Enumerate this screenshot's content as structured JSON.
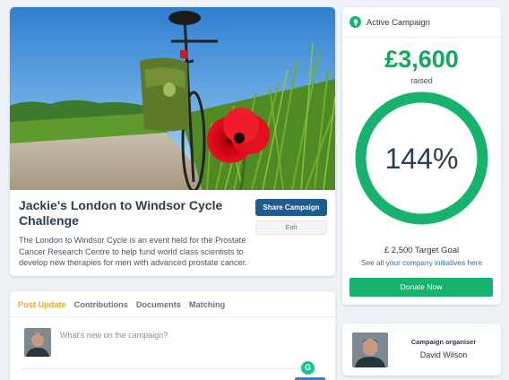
{
  "campaign": {
    "title": "Jackie's London to Windsor Cycle Challenge",
    "description": "The London to Windsor Cycle is an event held for the Prostate Cancer Research Centre to help fund world class scientists to develop new therapies for men with advanced prostate cancer.",
    "share_label": "Share Campaign",
    "edit_label": "Edit"
  },
  "post_update": {
    "tabs": [
      {
        "label": "Post Update",
        "active": true
      },
      {
        "label": "Contributions",
        "active": false
      },
      {
        "label": "Documents",
        "active": false
      },
      {
        "label": "Matching",
        "active": false
      }
    ],
    "placeholder": "What's new on the campaign?",
    "grammarly_icon": "G"
  },
  "active_campaign": {
    "header": "Active Campaign",
    "icon": "rocket-icon",
    "raised_amount": "£3,600",
    "raised_label": "raised",
    "progress_percent": 144,
    "progress_label": "144%",
    "target_goal": "£ 2,500 Target Goal",
    "initiatives_link": "See all your company initiatives here",
    "donate_label": "Donate Now"
  },
  "organiser": {
    "label": "Campaign organiser",
    "name": "David Wilson"
  },
  "colors": {
    "brand_green": "#15b36c",
    "share_blue": "#1f5a93",
    "active_tab": "#f0a830",
    "link_blue": "#2b6cb0"
  }
}
